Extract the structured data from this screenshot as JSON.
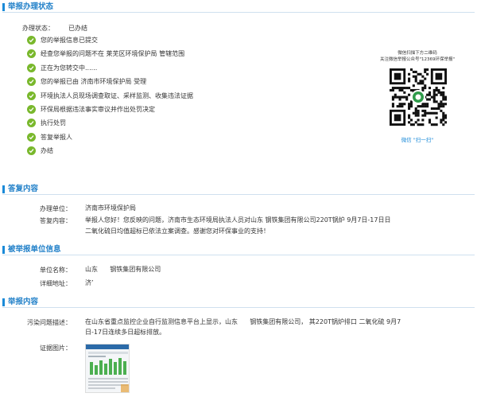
{
  "status_section": {
    "title": "举报办理状态",
    "status_label": "办理状态：",
    "status_value": "已办结",
    "steps": [
      "您的举报信息已提交",
      "经查您举报的问题不在 莱芜区环境保护局 管辖范围",
      "正在为您转交中......",
      "您的举报已由 济南市环境保护局 受理",
      "环境执法人员现场调查取证、采样监测、收集违法证据",
      "环保局根据违法事实审议并作出处罚决定",
      "执行处罚",
      "答复举报人",
      "办结"
    ],
    "qr_caption_1": "微信扫描下方二维码",
    "qr_caption_2": "关注微信举报公众号\"12369环保举报\"",
    "qr_footer": "微信 \"扫一扫\""
  },
  "reply_section": {
    "title": "答复内容",
    "unit_label": "办理单位：",
    "unit_value": "济南市环境保护局",
    "content_label": "答复内容：",
    "content_line1": "举报人您好！您反映的问题，济南市生态环境局执法人员对山东      钢铁集团有限公司220T锅炉 9月7日-17日日",
    "content_line2": "二氧化硫日均值超标已依法立案调查。感谢您对环保事业的支持！"
  },
  "reported_section": {
    "title": "被举报单位信息",
    "name_label": "单位名称：",
    "name_value": "山东      钢铁集团有限公司",
    "addr_label": "详细地址：",
    "addr_value": "济’"
  },
  "report_section": {
    "title": "举报内容",
    "desc_label": "污染问题描述：",
    "desc_line1": "在山东省重点监控企业自行监测信息平台上显示，山东      钢铁集团有限公司， 其220T锅炉排口 二氧化硫 9月7",
    "desc_line2": "日-17日连续多日超标排放。",
    "evidence_label": "证据图片："
  },
  "colors": {
    "accent": "#1f7fc8",
    "check": "#79b82c"
  }
}
